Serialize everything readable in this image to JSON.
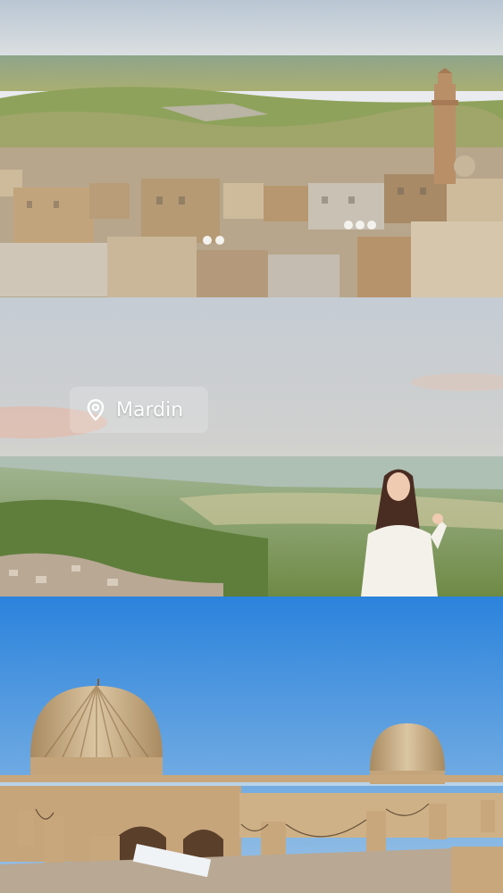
{
  "location_tag": {
    "label": "Mardin",
    "icon": "location-pin-icon"
  },
  "panels": [
    {
      "id": "city-overview"
    },
    {
      "id": "valley-portrait"
    },
    {
      "id": "domed-rooftops"
    }
  ],
  "colors": {
    "sky_top": "#c9d3dc",
    "sky_mid": "#d7d4cc",
    "blue_sky": "#2f86dc",
    "stone": "#c9ab7e",
    "hills": "#7f9a52"
  }
}
